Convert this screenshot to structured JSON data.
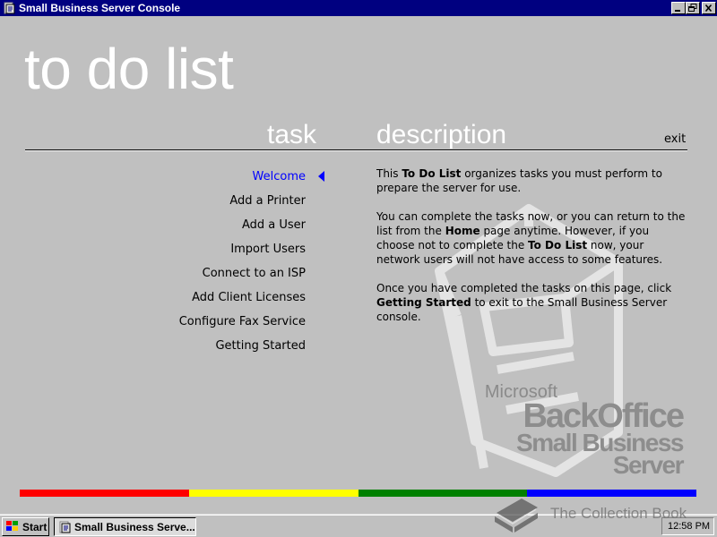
{
  "window": {
    "title": "Small Business Server Console"
  },
  "page": {
    "title": "to do list",
    "task_header": "task",
    "description_header": "description",
    "exit_label": "exit"
  },
  "tasks": [
    {
      "label": "Welcome",
      "active": true
    },
    {
      "label": "Add a Printer",
      "active": false
    },
    {
      "label": "Add a User",
      "active": false
    },
    {
      "label": "Import Users",
      "active": false
    },
    {
      "label": "Connect to an ISP",
      "active": false
    },
    {
      "label": "Add Client Licenses",
      "active": false
    },
    {
      "label": "Configure Fax Service",
      "active": false
    },
    {
      "label": "Getting Started",
      "active": false
    }
  ],
  "description": {
    "p1": {
      "a": "This ",
      "b": "To Do List",
      "c": " organizes tasks you must perform to prepare the server for use."
    },
    "p2": {
      "a": "You can complete the tasks now, or you can return to the list from the ",
      "b": "Home",
      "c": " page anytime. However, if you choose not to complete the ",
      "d": "To Do List",
      "e": " now, your network users will not have access to some features."
    },
    "p3": {
      "a": "Once you have completed the tasks on this page, click ",
      "b": "Getting Started",
      "c": " to exit to the Small Business Server console."
    }
  },
  "logo": {
    "microsoft": "Microsoft",
    "backoffice": "BackOffice",
    "line1": "Small Business",
    "line2": "Server"
  },
  "color_bar": [
    "#ff0000",
    "#ffff00",
    "#008000",
    "#0000ff"
  ],
  "taskbar": {
    "start_label": "Start",
    "task_button_label": "Small Business Serve...",
    "clock": "12:58 PM"
  },
  "watermark": {
    "text": "The Collection Book"
  },
  "colors": {
    "title_bar": "#000080",
    "active_task": "#0000ff",
    "background": "#c0c0c0"
  },
  "icons": {
    "title": "sbs-console-icon",
    "active_marker": "left-triangle-icon",
    "start": "windows-flag-icon",
    "watermark": "book-icon"
  }
}
